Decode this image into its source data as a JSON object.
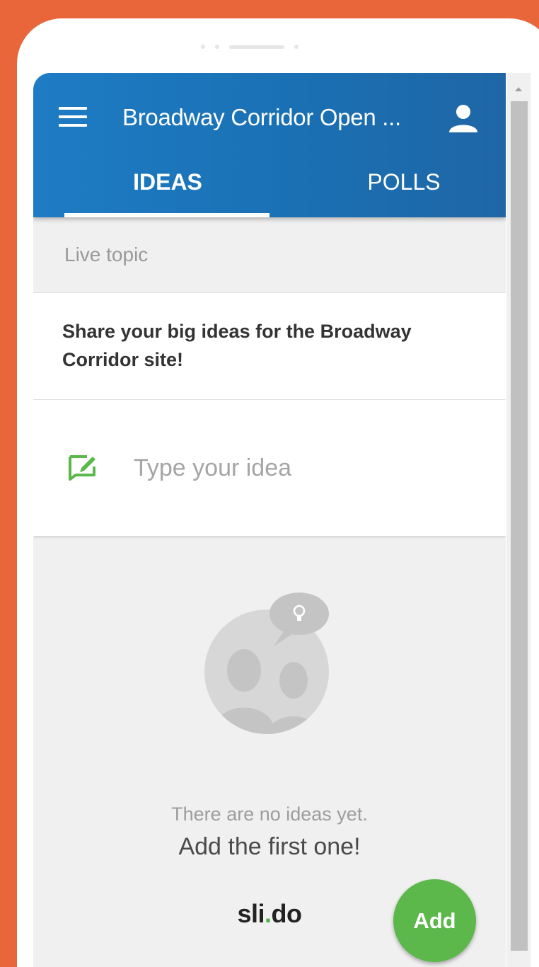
{
  "header": {
    "title": "Broadway Corridor Open ...",
    "menu_icon": "hamburger-menu-icon",
    "user_icon": "user-icon"
  },
  "tabs": [
    {
      "label": "IDEAS",
      "active": true
    },
    {
      "label": "POLLS",
      "active": false
    }
  ],
  "topic": {
    "section_label": "Live topic",
    "text": "Share your big ideas for the Broadway Corridor site!"
  },
  "idea_input": {
    "placeholder": "Type your idea",
    "icon": "edit-idea-icon"
  },
  "empty_state": {
    "message": "There are no ideas yet.",
    "cta": "Add the first one!",
    "illustration": "people-idea-bubble-icon"
  },
  "branding": {
    "logo_left": "sli",
    "logo_dot": ".",
    "logo_right": "do"
  },
  "fab": {
    "label": "Add"
  },
  "colors": {
    "background": "#e8663a",
    "appbar": "#1e7cc4",
    "accent_green": "#5cb84a",
    "surface": "#f0f0f0"
  }
}
